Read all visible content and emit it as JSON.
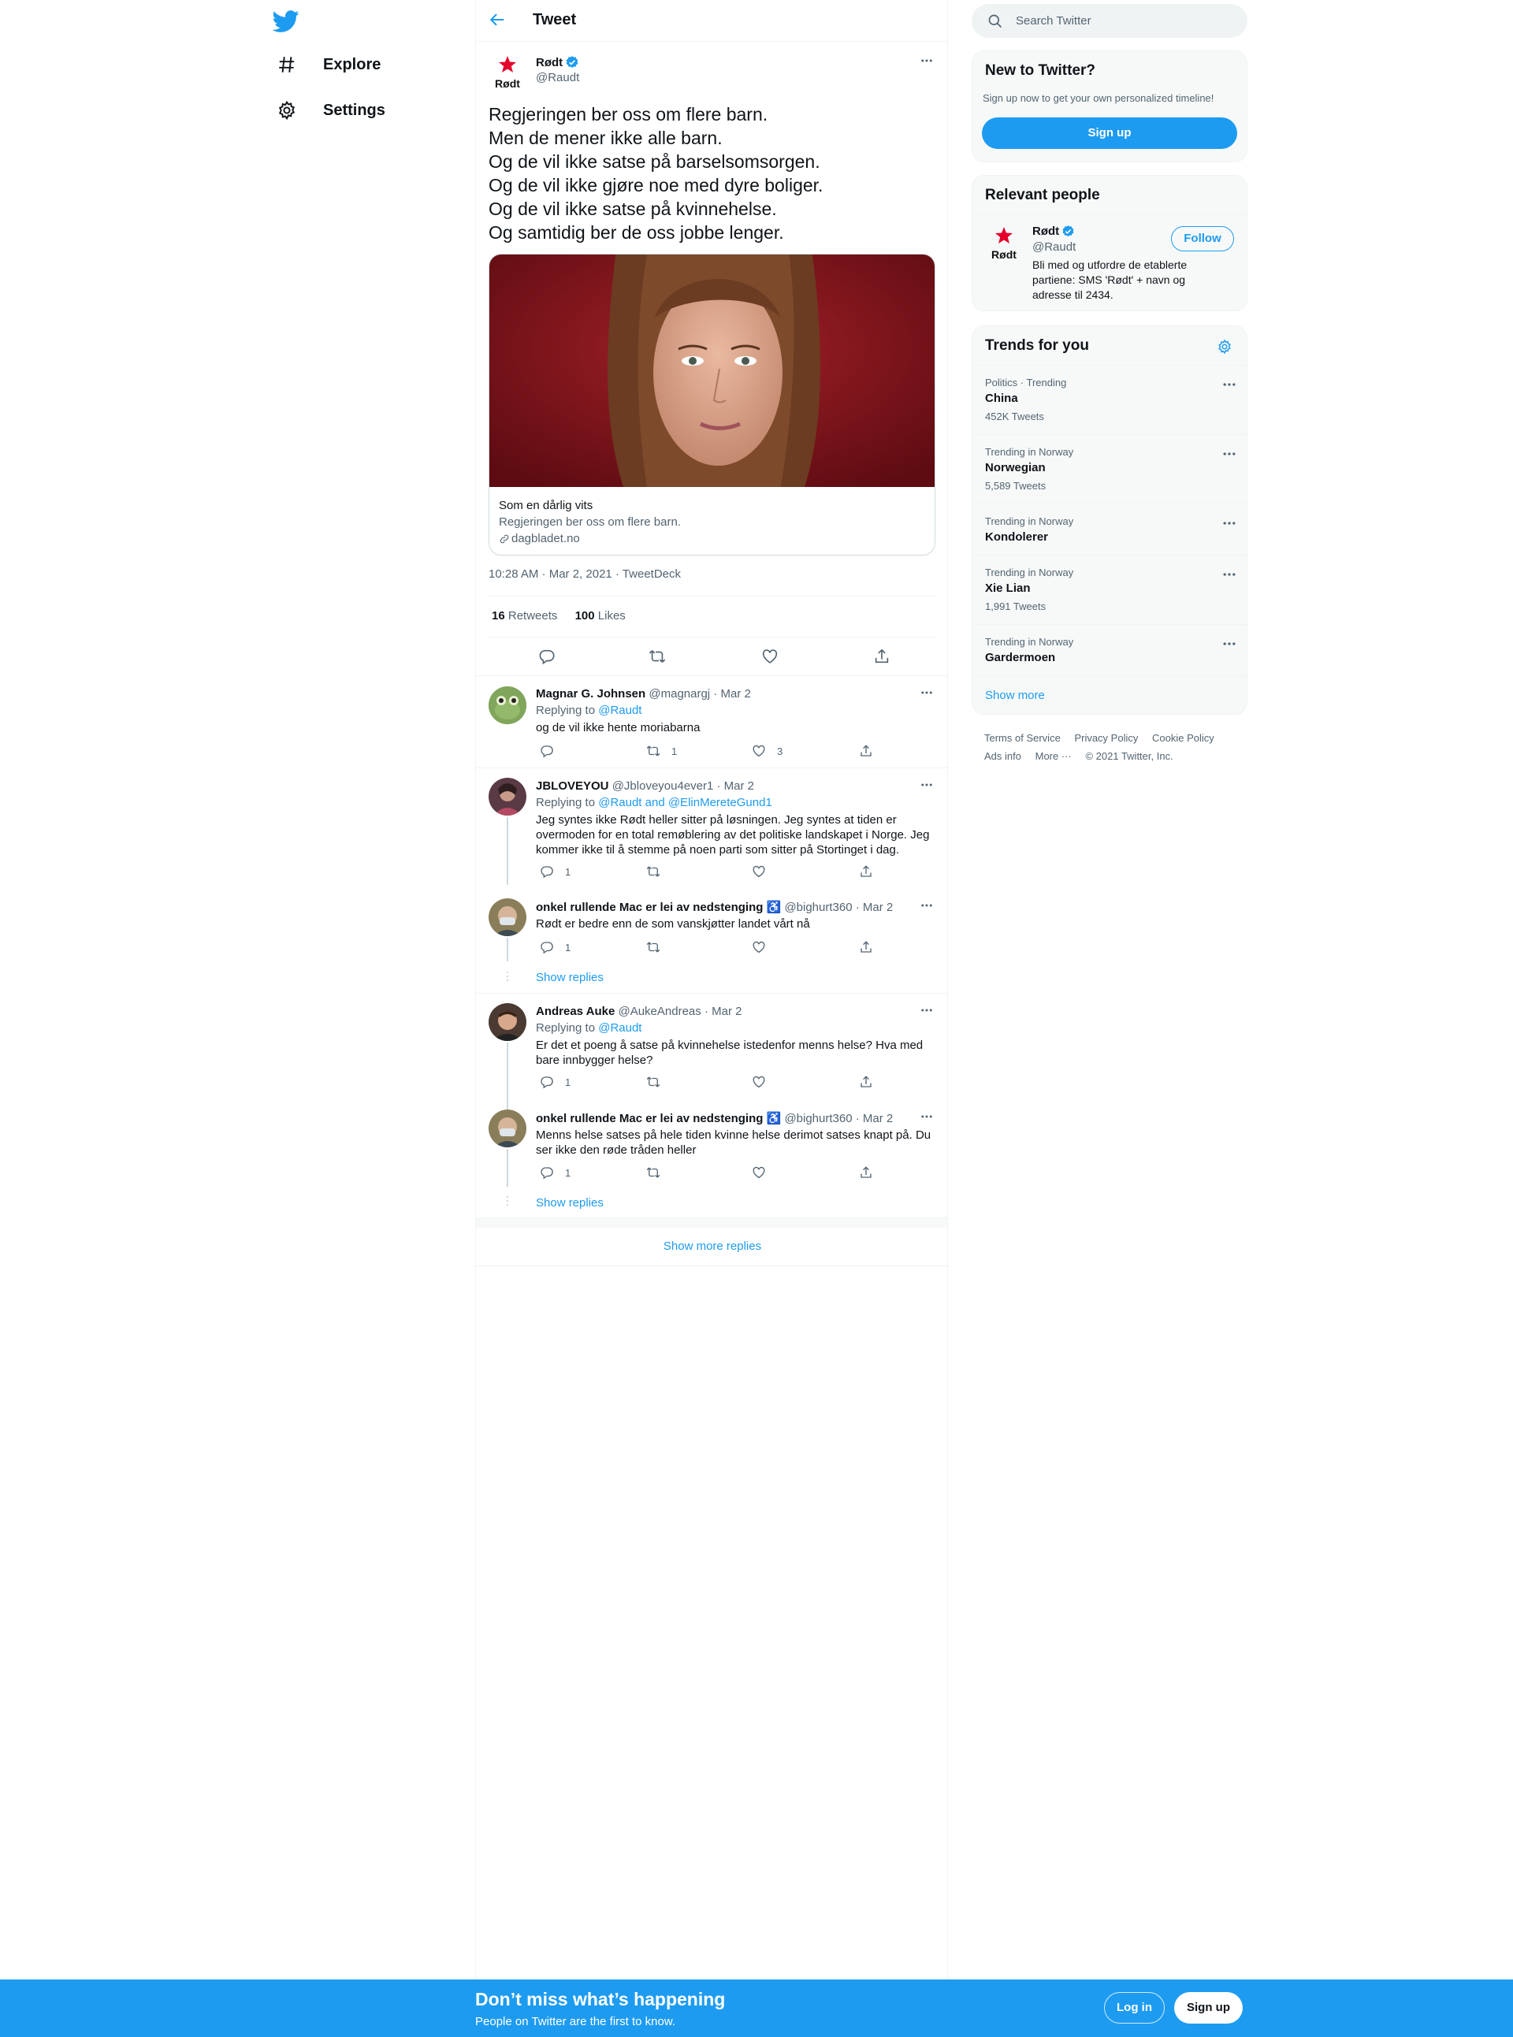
{
  "nav": {
    "items": [
      {
        "label": "Explore",
        "icon": "hashtag-icon"
      },
      {
        "label": "Settings",
        "icon": "gear-icon"
      }
    ]
  },
  "header": {
    "title": "Tweet"
  },
  "tweet": {
    "name": "Rødt",
    "handle": "@Raudt",
    "avatar_text": "Rødt",
    "lines": [
      "Regjeringen ber oss om flere barn.",
      "Men de mener ikke alle barn.",
      "Og de vil ikke satse på barselsomsorgen.",
      "Og de vil ikke gjøre noe med dyre boliger.",
      "Og de vil ikke satse på kvinnehelse.",
      "Og samtidig ber de oss jobbe lenger."
    ],
    "card": {
      "title": "Som en dårlig vits",
      "description": "Regjeringen ber oss om flere barn.",
      "domain": "dagbladet.no"
    },
    "meta": "10:28 AM · Mar 2, 2021 · TweetDeck",
    "retweets_count": "16",
    "retweets_label": "Retweets",
    "likes_count": "100",
    "likes_label": "Likes"
  },
  "replies": [
    {
      "name": "Magnar G. Johnsen",
      "handle": "@magnargj",
      "date": "· Mar 2",
      "replying_prefix": "Replying to ",
      "replying_to": "@Raudt",
      "text": "og de vil ikke hente moriabarna",
      "reply_count": "",
      "retweet_count": "1",
      "like_count": "3"
    },
    {
      "name": "JBLOVEYOU",
      "handle": "@Jbloveyou4ever1",
      "date": "· Mar 2",
      "replying_prefix": "Replying to ",
      "replying_to": "@Raudt and @ElinMereteGund1",
      "text": "Jeg syntes ikke Rødt heller sitter på løsningen. Jeg syntes at tiden er overmoden for en total remøblering av det politiske landskapet i Norge. Jeg kommer ikke til å stemme på noen parti som sitter på Stortinget i dag.",
      "reply_count": "1",
      "retweet_count": "",
      "like_count": ""
    },
    {
      "name": "onkel rullende Mac er lei av nedstenging ♿",
      "handle": "@bighurt360",
      "date": "· Mar 2",
      "text": "Rødt er bedre enn de som vanskjøtter landet vårt nå",
      "reply_count": "1",
      "retweet_count": "",
      "like_count": ""
    },
    {
      "name": "Andreas Auke",
      "handle": "@AukeAndreas",
      "date": "· Mar 2",
      "replying_prefix": "Replying to ",
      "replying_to": "@Raudt",
      "text": "Er det et poeng å satse på kvinnehelse istedenfor menns helse? Hva med bare innbygger helse?",
      "reply_count": "1",
      "retweet_count": "",
      "like_count": ""
    },
    {
      "name": "onkel rullende Mac er lei av nedstenging ♿",
      "handle": "@bighurt360",
      "date": "· Mar 2",
      "text": "Menns helse satses på hele tiden kvinne helse derimot satses knapt på. Du ser ikke den røde tråden heller",
      "reply_count": "1",
      "retweet_count": "",
      "like_count": ""
    }
  ],
  "show_replies": "Show replies",
  "show_more_replies": "Show more replies",
  "search": {
    "placeholder": "Search Twitter"
  },
  "new_to_twitter": {
    "title": "New to Twitter?",
    "subtitle": "Sign up now to get your own personalized timeline!",
    "button": "Sign up"
  },
  "relevant": {
    "title": "Relevant people",
    "name": "Rødt",
    "handle": "@Raudt",
    "follow": "Follow",
    "bio": [
      "Bli med og utfordre de etablerte",
      "partiene: SMS 'Rødt' + navn og",
      "adresse til 2434."
    ]
  },
  "trends": {
    "title": "Trends for you",
    "items": [
      {
        "category": "Politics · Trending",
        "name": "China",
        "count": "452K Tweets"
      },
      {
        "category": "Trending in Norway",
        "name": "Norwegian",
        "count": "5,589 Tweets"
      },
      {
        "category": "Trending in Norway",
        "name": "Kondolerer",
        "count": ""
      },
      {
        "category": "Trending in Norway",
        "name": "Xie Lian",
        "count": "1,991 Tweets"
      },
      {
        "category": "Trending in Norway",
        "name": "Gardermoen",
        "count": ""
      }
    ],
    "show_more": "Show more"
  },
  "footer": {
    "links": [
      "Terms of Service",
      "Privacy Policy",
      "Cookie Policy",
      "Ads info",
      "More ···"
    ],
    "copyright": "© 2021 Twitter, Inc."
  },
  "banner": {
    "title": "Don’t miss what’s happening",
    "subtitle": "People on Twitter are the first to know.",
    "login": "Log in",
    "signup": "Sign up"
  },
  "colors": {
    "accent": "#1d9bf0",
    "rodt_red": "#e4002b"
  }
}
